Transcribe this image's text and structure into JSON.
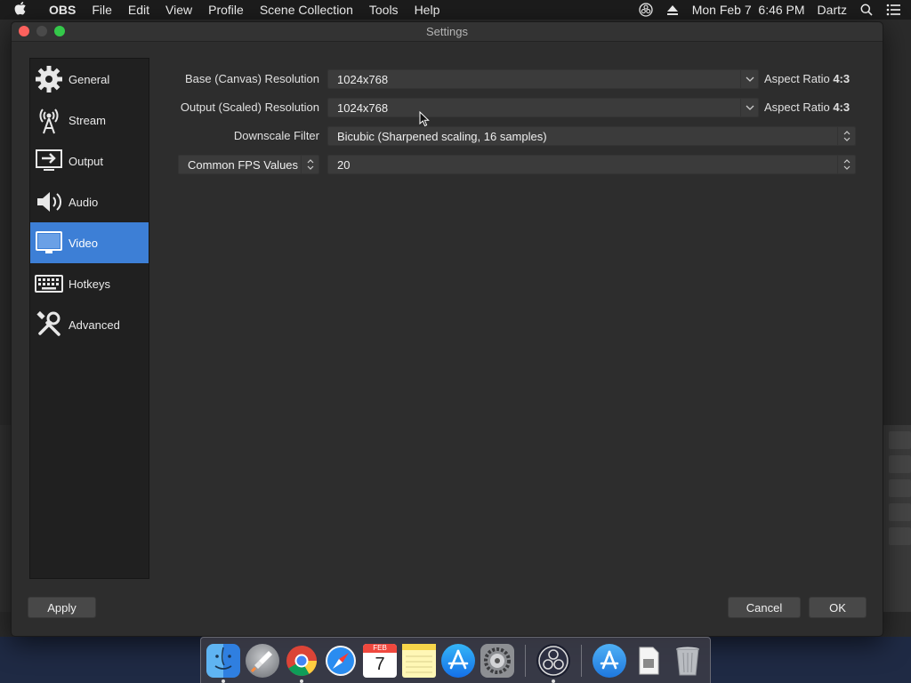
{
  "menubar": {
    "app_name": "OBS",
    "items": [
      "File",
      "Edit",
      "View",
      "Profile",
      "Scene Collection",
      "Tools",
      "Help"
    ],
    "clock": "Mon Feb 7  6:46 PM",
    "user": "Dartz"
  },
  "window": {
    "title": "Settings"
  },
  "sidebar": {
    "items": [
      {
        "label": "General",
        "icon": "gear-icon"
      },
      {
        "label": "Stream",
        "icon": "broadcast-icon"
      },
      {
        "label": "Output",
        "icon": "output-icon"
      },
      {
        "label": "Audio",
        "icon": "speaker-icon"
      },
      {
        "label": "Video",
        "icon": "monitor-icon",
        "active": true
      },
      {
        "label": "Hotkeys",
        "icon": "keyboard-icon"
      },
      {
        "label": "Advanced",
        "icon": "tools-icon"
      }
    ]
  },
  "video": {
    "base_label": "Base (Canvas) Resolution",
    "base_value": "1024x768",
    "base_aspect_prefix": "Aspect Ratio",
    "base_aspect_value": "4:3",
    "output_label": "Output (Scaled) Resolution",
    "output_value": "1024x768",
    "output_aspect_prefix": "Aspect Ratio",
    "output_aspect_value": "4:3",
    "downscale_label": "Downscale Filter",
    "downscale_value": "Bicubic (Sharpened scaling, 16 samples)",
    "fps_type_value": "Common FPS Values",
    "fps_value": "20"
  },
  "buttons": {
    "apply": "Apply",
    "cancel": "Cancel",
    "ok": "OK"
  },
  "calendar_tile": {
    "month": "FEB",
    "day": "7"
  },
  "colors": {
    "accent": "#3d7fd6",
    "window_bg": "#2d2d2d",
    "sidebar_bg": "#202020"
  }
}
